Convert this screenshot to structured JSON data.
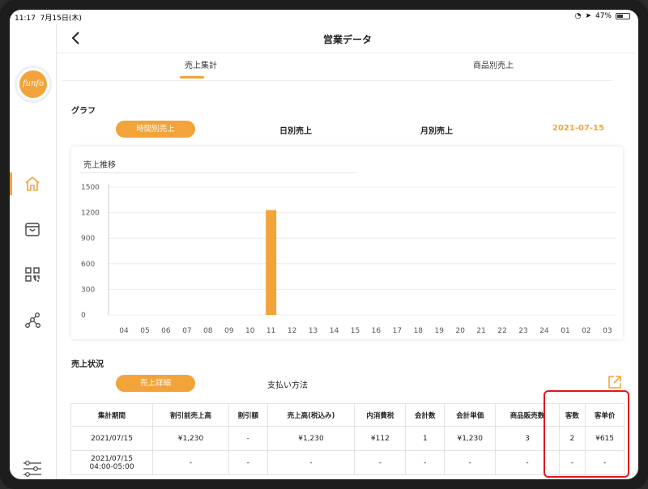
{
  "status": {
    "time": "11:17",
    "date": "7月15日(木)",
    "battery": "47%"
  },
  "logo": "funfo",
  "header": {
    "title": "営業データ"
  },
  "top_tabs": [
    {
      "label": "売上集計",
      "active": true
    },
    {
      "label": "商品別売上",
      "active": false
    }
  ],
  "graph": {
    "section_title": "グラフ",
    "tabs": [
      {
        "label": "時間別売上",
        "active": true
      },
      {
        "label": "日別売上"
      },
      {
        "label": "月別売上"
      }
    ],
    "date": "2021-07-15"
  },
  "chart_data": {
    "type": "bar",
    "title": "売上推移",
    "categories": [
      "04",
      "05",
      "06",
      "07",
      "08",
      "09",
      "10",
      "11",
      "12",
      "13",
      "14",
      "15",
      "16",
      "17",
      "18",
      "19",
      "20",
      "21",
      "22",
      "23",
      "24",
      "01",
      "02",
      "03"
    ],
    "values": [
      0,
      0,
      0,
      0,
      0,
      0,
      0,
      1230,
      0,
      0,
      0,
      0,
      0,
      0,
      0,
      0,
      0,
      0,
      0,
      0,
      0,
      0,
      0,
      0
    ],
    "yticks": [
      "1500",
      "1200",
      "900",
      "600",
      "300",
      "0"
    ],
    "ylim": [
      0,
      1500
    ],
    "grid": true,
    "bar_color": "#f2a33a"
  },
  "sales": {
    "section_title": "売上状況",
    "tabs": [
      {
        "label": "売上詳細",
        "active": true
      },
      {
        "label": "支払い方法"
      }
    ],
    "columns": [
      "集計期間",
      "割引前売上高",
      "割引額",
      "売上高(税込み)",
      "内消費税",
      "会計数",
      "会計単価",
      "商品販売数",
      "客数",
      "客单价"
    ],
    "rows": [
      [
        "2021/07/15",
        "¥1,230",
        "-",
        "¥1,230",
        "¥112",
        "1",
        "¥1,230",
        "3",
        "2",
        "¥615"
      ],
      [
        "2021/07/15\n04:00-05:00",
        "-",
        "-",
        "-",
        "-",
        "-",
        "-",
        "-",
        "-",
        "-"
      ]
    ]
  },
  "colors": {
    "accent": "#f2a33a",
    "highlight": "#e4161c"
  }
}
